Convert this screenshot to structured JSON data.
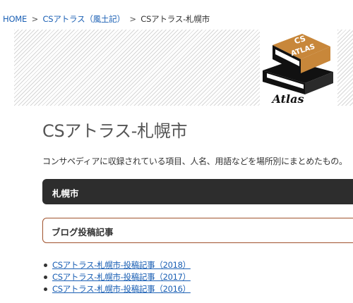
{
  "breadcrumb": {
    "home": "HOME",
    "separator": ">",
    "parent": "CSアトラス（風土記）",
    "current": "CSアトラス-札幌市"
  },
  "logo": {
    "book_top_text_1": "CS",
    "book_top_text_2": "ATLAS",
    "caption": "Atlas",
    "colors": {
      "book_cover": "#c8873a",
      "book_spine": "#111111"
    }
  },
  "page": {
    "title": "CSアトラス-札幌市",
    "intro": "コンサペディアに収録されている項目、人名、用語などを場所別にまとめたもの。"
  },
  "sections": {
    "city_heading": "札幌市",
    "blog_heading": "ブログ投稿記事"
  },
  "posts": [
    {
      "label": "CSアトラス-札幌市-投稿記事（2018）"
    },
    {
      "label": "CSアトラス-札幌市-投稿記事（2017）"
    },
    {
      "label": "CSアトラス-札幌市-投稿記事（2016）"
    }
  ],
  "colors": {
    "link": "#1a5fb4",
    "dark_bar": "#2d2d2d",
    "outline_border": "#a0522d"
  }
}
